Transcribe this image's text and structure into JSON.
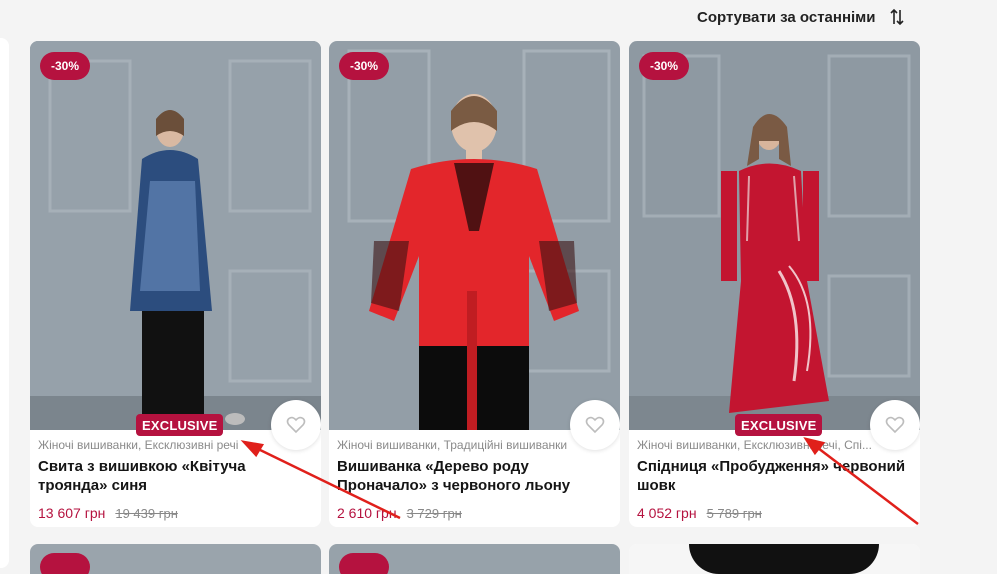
{
  "sort": {
    "label": "Сортувати за останніми",
    "icon": "sort-arrows-icon"
  },
  "colors": {
    "accent": "#b5123f",
    "annotation_arrow": "#e0201b"
  },
  "products": [
    {
      "discount": "-30%",
      "badge": "EXCLUSIVE",
      "categories": "Жіночі вишиванки, Ексклюзивні речі",
      "title": "Свита з вишивкою «Квітуча троянда» синя",
      "price": "13 607 грн",
      "old_price": "19 439 грн"
    },
    {
      "discount": "-30%",
      "badge": "",
      "categories": "Жіночі вишиванки, Традиційні вишиванки",
      "title": "Вишиванка «Дерево роду Проначало» з червоного льону",
      "price": "2 610 грн",
      "old_price": "3 729 грн"
    },
    {
      "discount": "-30%",
      "badge": "EXCLUSIVE",
      "categories": "Жіночі вишиванки, Ексклюзивні речі, Спі...",
      "title": "Спідниця «Пробудження» червоний шовк",
      "price": "4 052 грн",
      "old_price": "5 789 грн"
    }
  ]
}
